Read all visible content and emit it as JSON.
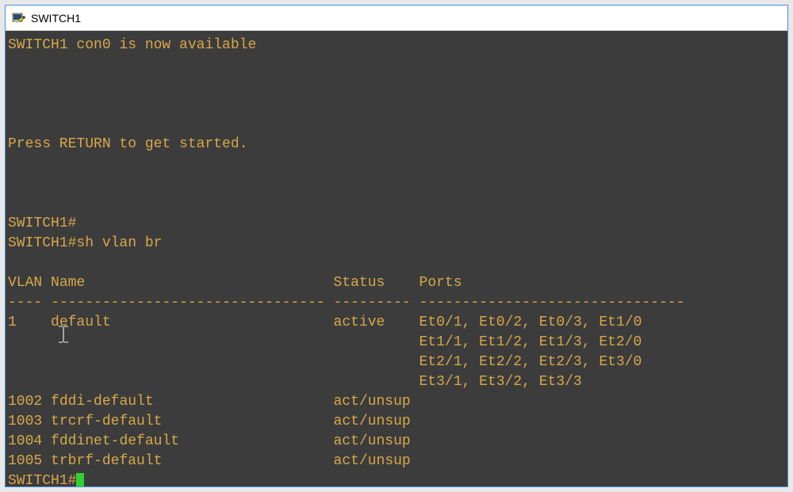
{
  "window": {
    "title": "SWITCH1"
  },
  "terminal": {
    "banner_line": "SWITCH1 con0 is now available",
    "press_return": "Press RETURN to get started.",
    "prompt_empty": "SWITCH1#",
    "prompt_cmd_prefix": "SWITCH1#",
    "command": "sh vlan br",
    "header": {
      "vlan": "VLAN",
      "name": "Name",
      "status": "Status",
      "ports": "Ports"
    },
    "separator": {
      "col1": "----",
      "col2": "--------------------------------",
      "col3": "---------",
      "col4": "-------------------------------"
    },
    "rows": [
      {
        "vlan": "1",
        "name": "default",
        "status": "active",
        "ports_lines": [
          "Et0/1, Et0/2, Et0/3, Et1/0",
          "Et1/1, Et1/2, Et1/3, Et2/0",
          "Et2/1, Et2/2, Et2/3, Et3/0",
          "Et3/1, Et3/2, Et3/3"
        ]
      },
      {
        "vlan": "1002",
        "name": "fddi-default",
        "status": "act/unsup",
        "ports_lines": []
      },
      {
        "vlan": "1003",
        "name": "trcrf-default",
        "status": "act/unsup",
        "ports_lines": []
      },
      {
        "vlan": "1004",
        "name": "fddinet-default",
        "status": "act/unsup",
        "ports_lines": []
      },
      {
        "vlan": "1005",
        "name": "trbrf-default",
        "status": "act/unsup",
        "ports_lines": []
      }
    ],
    "final_prompt": "SWITCH1#"
  },
  "colors": {
    "terminal_bg": "#3c3c3c",
    "terminal_fg": "#d8a849",
    "cursor": "#30d030"
  }
}
